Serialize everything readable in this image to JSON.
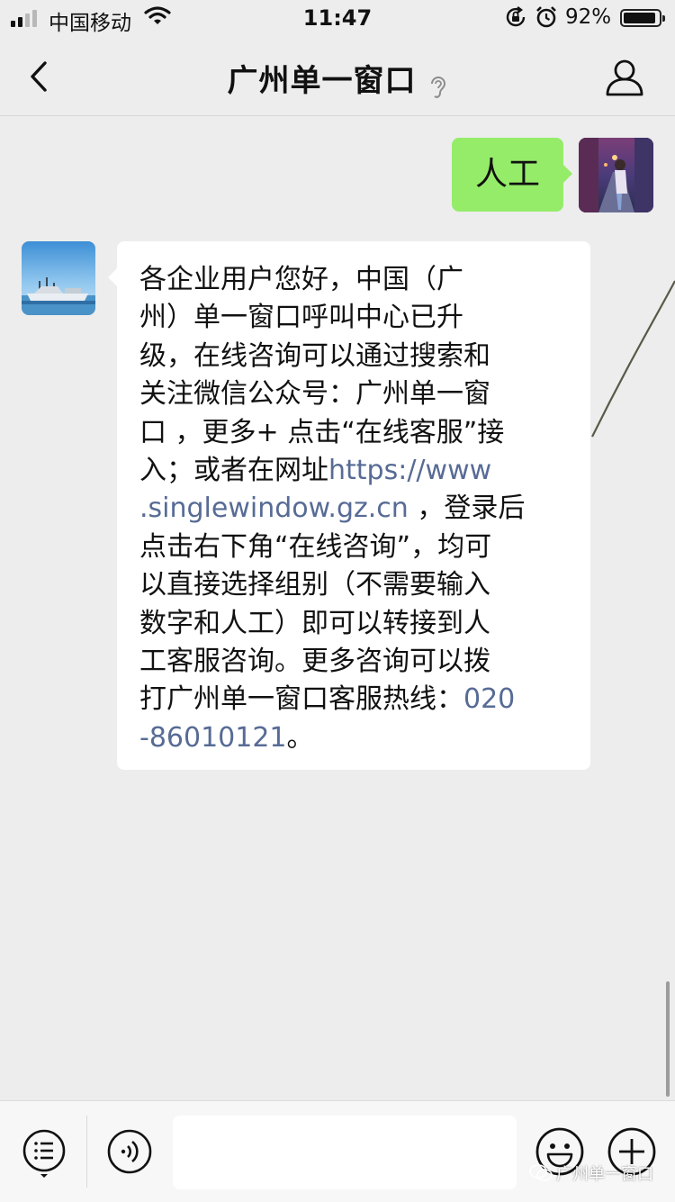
{
  "status_bar": {
    "carrier": "中国移动",
    "time": "11:47",
    "battery_percent_text": "92%",
    "battery_level": 0.92
  },
  "nav": {
    "title": "广州单一窗口",
    "icons": [
      "back-arrow-icon",
      "ear-icon",
      "profile-icon"
    ]
  },
  "messages": {
    "outgoing": {
      "text": "人工"
    },
    "incoming": {
      "lines": [
        [
          {
            "t": "各企业用户您好，中国（广"
          }
        ],
        [
          {
            "t": "州）单一窗口呼叫中心已升"
          }
        ],
        [
          {
            "t": "级，在线咨询可以通过搜索和"
          }
        ],
        [
          {
            "t": "关注微信公众号：广州单一窗"
          }
        ],
        [
          {
            "t": "口 ，更多+ 点击“在线客服”接"
          }
        ],
        [
          {
            "t": "入；或者在网址"
          },
          {
            "t": "https://www",
            "link": true
          }
        ],
        [
          {
            "t": ".singlewindow.gz.cn",
            "link": true
          },
          {
            "t": " ，登录后"
          }
        ],
        [
          {
            "t": "点击右下角“在线咨询”，均可"
          }
        ],
        [
          {
            "t": "以直接选择组别（不需要输入"
          }
        ],
        [
          {
            "t": "数字和人工）即可以转接到人"
          }
        ],
        [
          {
            "t": "工客服咨询。更多咨询可以拨"
          }
        ],
        [
          {
            "t": "打广州单一窗口客服热线："
          },
          {
            "t": "020",
            "link": true
          }
        ],
        [
          {
            "t": "-86010121",
            "link": true
          },
          {
            "t": "。"
          }
        ]
      ]
    }
  },
  "input_bar": {
    "placeholder": "",
    "icons": [
      "menu-list-icon",
      "voice-icon",
      "emoji-icon",
      "plus-icon"
    ]
  },
  "watermark": {
    "text": "广州单一窗口"
  },
  "colors": {
    "background": "#ededed",
    "outgoing_bubble": "#95ec69",
    "incoming_bubble": "#ffffff",
    "link": "#576b95"
  }
}
